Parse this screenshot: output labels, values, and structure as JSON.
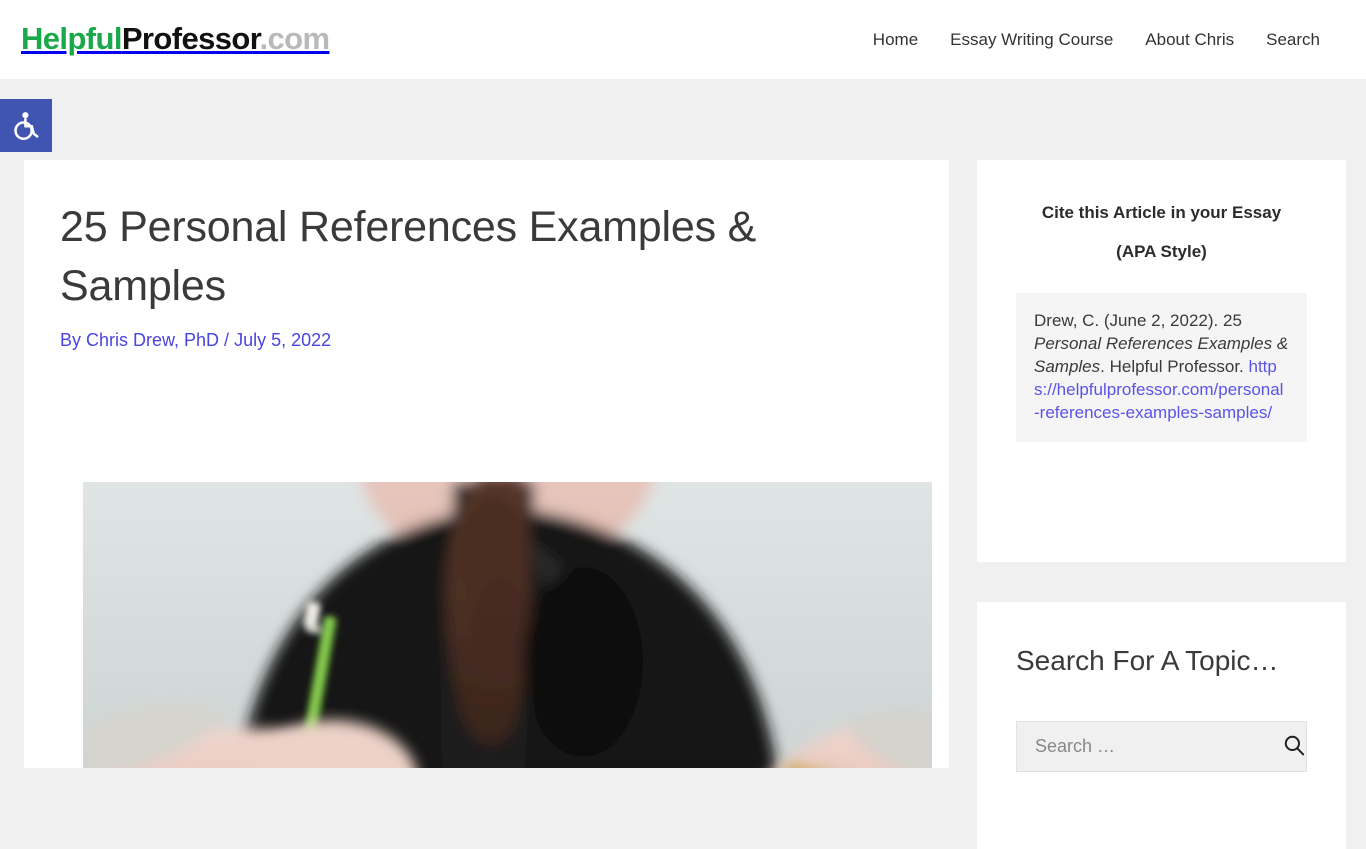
{
  "header": {
    "logo": {
      "part_green": "Helpful",
      "part_black": "Professor",
      "part_gray": ".com",
      "green_hex": "#1aa84a",
      "black_hex": "#111111",
      "gray_hex": "#b9b9b9"
    },
    "nav": [
      {
        "label": "Home",
        "name": "nav-item-home"
      },
      {
        "label": "Essay Writing Course",
        "name": "nav-item-essay-writing-course"
      },
      {
        "label": "About Chris",
        "name": "nav-item-about-chris"
      },
      {
        "label": "Search",
        "name": "nav-item-search"
      }
    ]
  },
  "accessibility": {
    "icon": "wheelchair-accessibility-icon",
    "background_hex": "#4054b2"
  },
  "article": {
    "title": "25 Personal References Examples & Samples",
    "byline_author": "By Chris Drew, PhD",
    "byline_separator": " / ",
    "byline_date": "July 5, 2022",
    "byline_color": "#4a45e0",
    "featured_image_alt": "Woman in black top writing with a green pencil in a spiral notebook"
  },
  "sidebar": {
    "cite_widget": {
      "heading_line1": "Cite this Article in your Essay",
      "heading_line2": "(APA Style)",
      "citation_prefix": "Drew, C. (June 2, 2022). ",
      "citation_number": "25 ",
      "citation_title_italic": "Personal References Examples & Samples",
      "citation_period": ". ",
      "citation_publisher": "Helpful Professor. ",
      "citation_url": "https://helpfulprofessor.com/personal-references-examples-samples/",
      "url_color": "#5a53e8",
      "box_background_hex": "#f5f5f5"
    },
    "search_widget": {
      "title": "Search For A Topic…",
      "input_value": "",
      "input_placeholder": "Search …",
      "submit_icon": "search-icon"
    }
  },
  "page": {
    "background_hex": "#f0f0f0",
    "card_background_hex": "#ffffff"
  }
}
